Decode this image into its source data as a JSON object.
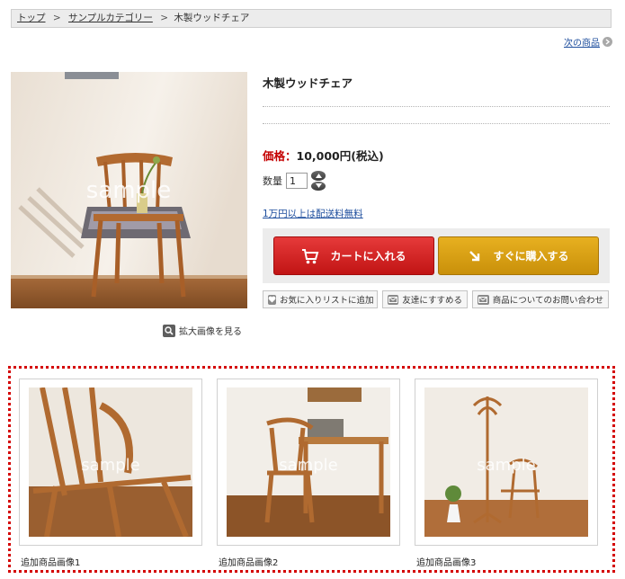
{
  "breadcrumb": {
    "items": [
      "トップ",
      "サンプルカテゴリー"
    ],
    "current": "木製ウッドチェア",
    "separator": ">"
  },
  "nav": {
    "next_label": "次の商品"
  },
  "product": {
    "title": "木製ウッドチェア",
    "price_label": "価格：",
    "price_value": "10,000円(税込)",
    "quantity_label": "数量",
    "quantity_value": "1",
    "free_shipping": "1万円以上は配送料無料",
    "zoom_label": "拡大画像を見る",
    "image_watermark": "sample"
  },
  "actions": {
    "cart_label": "カートに入れる",
    "buy_label": "すぐに購入する",
    "wishlist_label": "お気に入りリストに追加",
    "recommend_label": "友達にすすめる",
    "inquiry_label": "商品についてのお問い合わせ"
  },
  "extra_images": [
    {
      "caption": "追加商品画像1",
      "watermark": "sample"
    },
    {
      "caption": "追加商品画像2",
      "watermark": "sample"
    },
    {
      "caption": "追加商品画像3",
      "watermark": "sample"
    }
  ],
  "colors": {
    "price_red": "#c40000",
    "cart_red": "#d42020",
    "buy_gold": "#d9a014",
    "link_blue": "#1f4f9e",
    "dotted_border_red": "#d40000"
  }
}
